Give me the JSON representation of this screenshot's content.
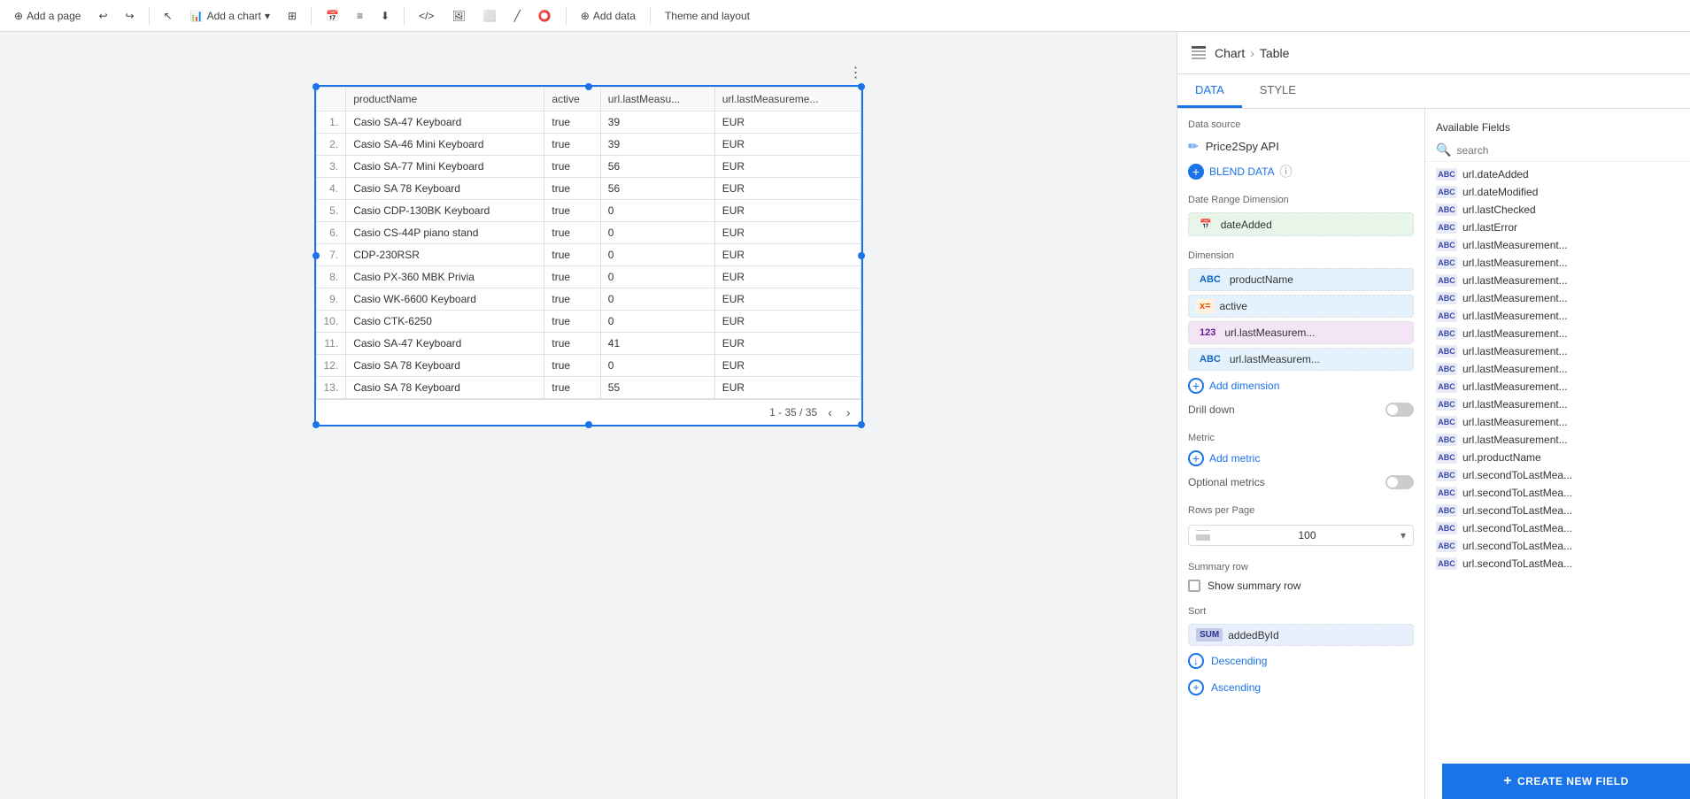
{
  "toolbar": {
    "add_page": "Add a page",
    "add_chart": "Add a chart",
    "add_data": "Add data",
    "theme_layout": "Theme and layout"
  },
  "table": {
    "columns": [
      "productName",
      "active",
      "url.lastMeasu...",
      "url.lastMeasureme..."
    ],
    "rows": [
      {
        "num": "1.",
        "productName": "Casio SA-47 Keyboard",
        "active": "true",
        "col3": "39",
        "col4": "EUR"
      },
      {
        "num": "2.",
        "productName": "Casio SA-46 Mini Keyboard",
        "active": "true",
        "col3": "39",
        "col4": "EUR"
      },
      {
        "num": "3.",
        "productName": "Casio SA-77 Mini Keyboard",
        "active": "true",
        "col3": "56",
        "col4": "EUR"
      },
      {
        "num": "4.",
        "productName": "Casio SA 78 Keyboard",
        "active": "true",
        "col3": "56",
        "col4": "EUR"
      },
      {
        "num": "5.",
        "productName": "Casio CDP-130BK Keyboard",
        "active": "true",
        "col3": "0",
        "col4": "EUR"
      },
      {
        "num": "6.",
        "productName": "Casio CS-44P piano stand",
        "active": "true",
        "col3": "0",
        "col4": "EUR"
      },
      {
        "num": "7.",
        "productName": "CDP-230RSR",
        "active": "true",
        "col3": "0",
        "col4": "EUR"
      },
      {
        "num": "8.",
        "productName": "Casio PX-360 MBK Privia",
        "active": "true",
        "col3": "0",
        "col4": "EUR"
      },
      {
        "num": "9.",
        "productName": "Casio WK-6600 Keyboard",
        "active": "true",
        "col3": "0",
        "col4": "EUR"
      },
      {
        "num": "10.",
        "productName": "Casio CTK-6250",
        "active": "true",
        "col3": "0",
        "col4": "EUR"
      },
      {
        "num": "11.",
        "productName": "Casio SA-47 Keyboard",
        "active": "true",
        "col3": "41",
        "col4": "EUR"
      },
      {
        "num": "12.",
        "productName": "Casio SA 78 Keyboard",
        "active": "true",
        "col3": "0",
        "col4": "EUR"
      },
      {
        "num": "13.",
        "productName": "Casio SA 78 Keyboard",
        "active": "true",
        "col3": "55",
        "col4": "EUR"
      }
    ],
    "pagination": "1 - 35 / 35"
  },
  "panel": {
    "chart_label": "Chart",
    "breadcrumb_sep": "›",
    "table_label": "Table",
    "tab_data": "DATA",
    "tab_style": "STYLE",
    "data_source_label": "Data source",
    "data_source_name": "Price2Spy API",
    "blend_data_label": "BLEND DATA",
    "date_range_label": "Date Range Dimension",
    "date_added_chip": "dateAdded",
    "dimension_label": "Dimension",
    "dim_productName": "productName",
    "dim_active": "active",
    "dim_url_lastMeasurem1": "url.lastMeasurem...",
    "dim_url_lastMeasurem2": "url.lastMeasurem...",
    "add_dimension": "Add dimension",
    "drill_down_label": "Drill down",
    "metric_label": "Metric",
    "add_metric": "Add metric",
    "optional_metrics_label": "Optional metrics",
    "rows_per_page_label": "Rows per Page",
    "rows_value": "100",
    "summary_row_label": "Summary row",
    "show_summary_label": "Show summary row",
    "sort_label": "Sort",
    "sort_field": "addedById",
    "descending_label": "Descending",
    "ascending_label": "Ascending",
    "create_new_field": "CREATE NEW FIELD"
  },
  "available_fields": {
    "title": "Available Fields",
    "search_placeholder": "search",
    "fields": [
      {
        "type": "ABC",
        "name": "url.dateAdded"
      },
      {
        "type": "ABC",
        "name": "url.dateModified"
      },
      {
        "type": "ABC",
        "name": "url.lastChecked"
      },
      {
        "type": "ABC",
        "name": "url.lastError"
      },
      {
        "type": "ABC",
        "name": "url.lastMeasurement..."
      },
      {
        "type": "ABC",
        "name": "url.lastMeasurement..."
      },
      {
        "type": "ABC",
        "name": "url.lastMeasurement..."
      },
      {
        "type": "ABC",
        "name": "url.lastMeasurement..."
      },
      {
        "type": "ABC",
        "name": "url.lastMeasurement..."
      },
      {
        "type": "ABC",
        "name": "url.lastMeasurement..."
      },
      {
        "type": "ABC",
        "name": "url.lastMeasurement..."
      },
      {
        "type": "ABC",
        "name": "url.lastMeasurement..."
      },
      {
        "type": "ABC",
        "name": "url.lastMeasurement..."
      },
      {
        "type": "ABC",
        "name": "url.lastMeasurement..."
      },
      {
        "type": "ABC",
        "name": "url.lastMeasurement..."
      },
      {
        "type": "ABC",
        "name": "url.lastMeasurement..."
      },
      {
        "type": "ABC",
        "name": "url.productName"
      },
      {
        "type": "ABC",
        "name": "url.secondToLastMea..."
      },
      {
        "type": "ABC",
        "name": "url.secondToLastMea..."
      },
      {
        "type": "ABC",
        "name": "url.secondToLastMea..."
      },
      {
        "type": "ABC",
        "name": "url.secondToLastMea..."
      },
      {
        "type": "ABC",
        "name": "url.secondToLastMea..."
      },
      {
        "type": "ABC",
        "name": "url.secondToLastMea..."
      }
    ]
  }
}
